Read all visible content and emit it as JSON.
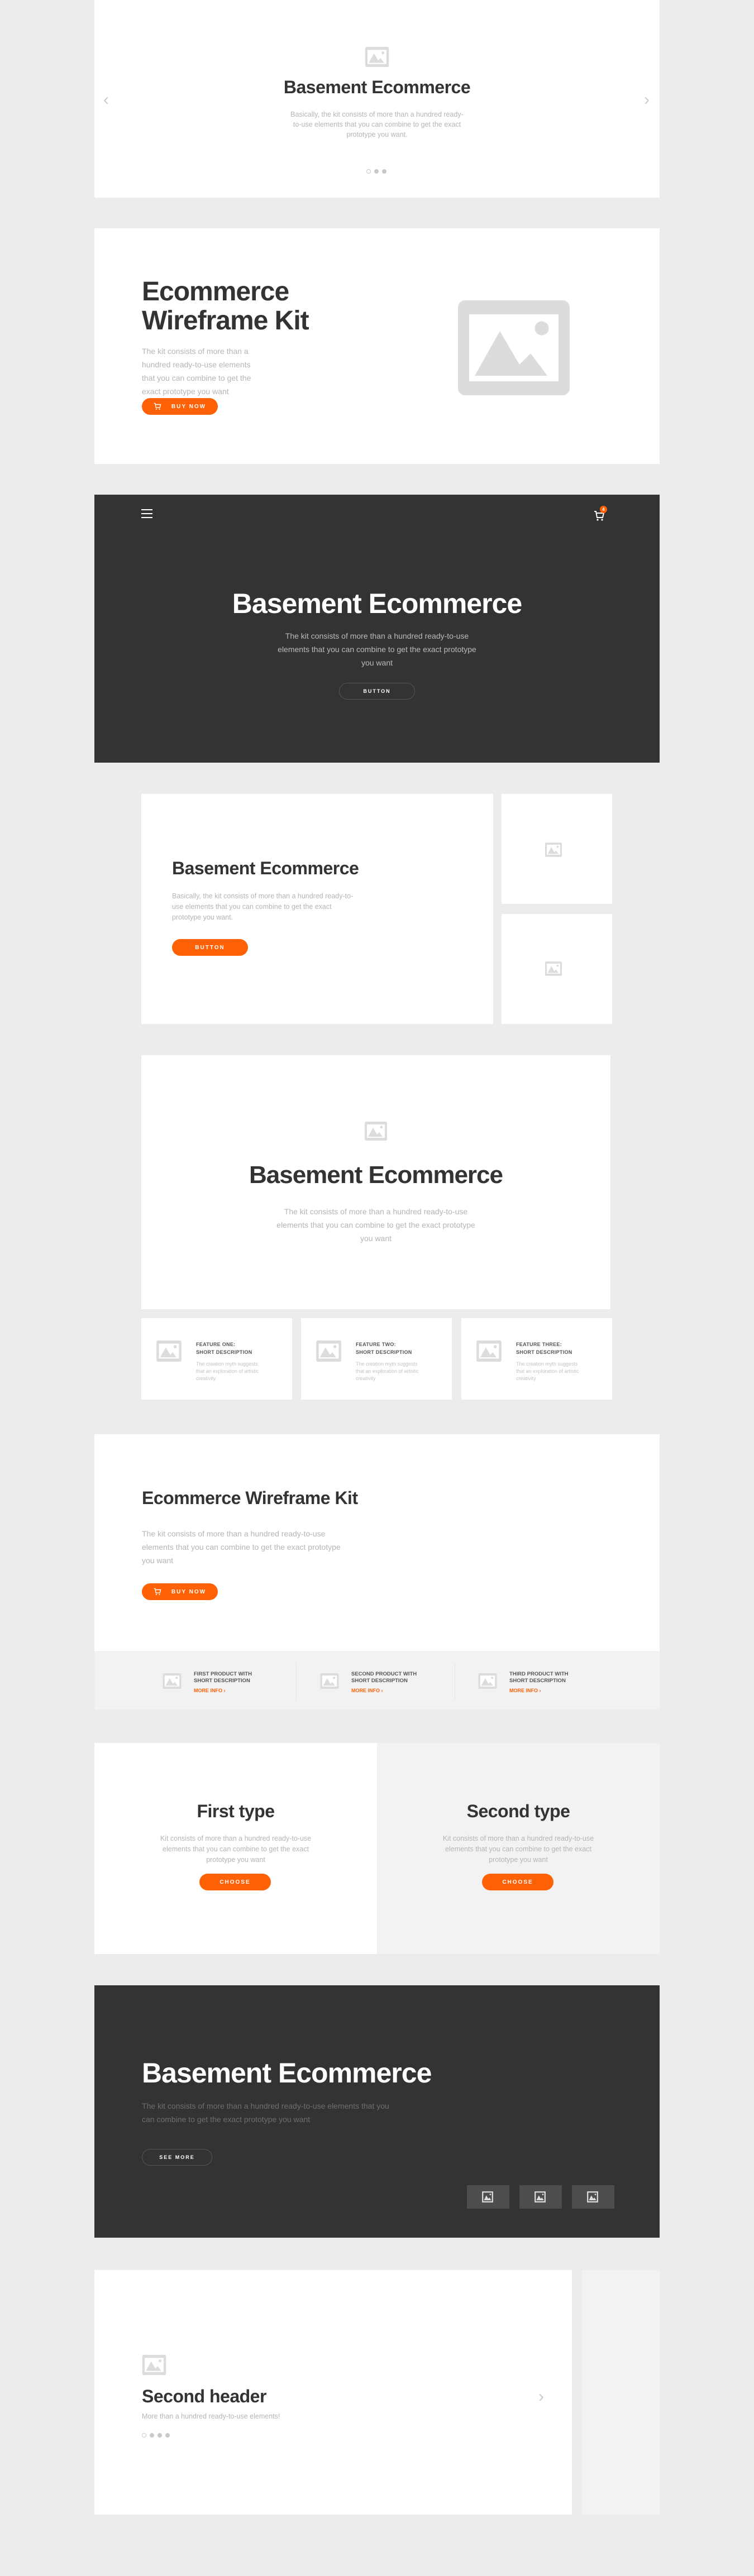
{
  "colors": {
    "accent": "#ff6206",
    "dark_bg": "#333333",
    "page_bg": "#ececec",
    "placeholder": "#dcdcdc"
  },
  "slider1": {
    "icon": "image-placeholder-icon",
    "title": "Basement Ecommerce",
    "text": "Basically, the kit consists of more than a hundred ready-to-use elements that you can combine to get the exact prototype you want.",
    "prev_icon": "chevron-left-icon",
    "next_icon": "chevron-right-icon",
    "dots": 3,
    "active_dot": 1
  },
  "hero_split": {
    "title_line1": "Ecommerce",
    "title_line2": "Wireframe Kit",
    "text": "The kit consists of more than a hundred ready-to-use elements that you can combine to get the exact prototype you want",
    "button": "BUY NOW",
    "button_icon": "cart-icon",
    "image_icon": "image-placeholder-icon"
  },
  "dark_hero": {
    "menu_icon": "hamburger-icon",
    "cart_icon": "cart-icon",
    "cart_count": "4",
    "title": "Basement Ecommerce",
    "text": "The kit consists of more than a hundred ready-to-use elements that you can combine to get the exact prototype you want",
    "button": "BUTTON"
  },
  "grid_hero": {
    "title": "Basement Ecommerce",
    "text": "Basically, the kit consists of more than a hundred ready-to-use elements that you can combine to get the exact prototype you want.",
    "button": "BUTTON"
  },
  "feature_hero": {
    "title": "Basement Ecommerce",
    "text": "The kit consists of more than a hundred ready-to-use elements that you can combine to get the exact prototype you want",
    "features": [
      {
        "title1": "FEATURE ONE:",
        "title2": "SHORT DESCRIPTION",
        "desc": "The creation myth suggests that an exploration of artistic creativity"
      },
      {
        "title1": "FEATURE TWO:",
        "title2": "SHORT DESCRIPTION",
        "desc": "The creation myth suggests that an exploration of artistic creativity"
      },
      {
        "title1": "FEATURE THREE:",
        "title2": "SHORT DESCRIPTION",
        "desc": "The creation myth suggests that an exploration of artistic creativity"
      }
    ]
  },
  "product_hero": {
    "title": "Ecommerce Wireframe Kit",
    "text": "The kit consists of more than a hundred ready-to-use elements that you can combine to get the exact prototype you want",
    "button": "BUY NOW",
    "products": [
      {
        "title1": "FIRST PRODUCT  WITH",
        "title2": "SHORT DESCRIPTION",
        "link": "MORE INFO  ›"
      },
      {
        "title1": "SECOND PRODUCT  WITH",
        "title2": "SHORT DESCRIPTION",
        "link": "MORE INFO  ›"
      },
      {
        "title1": "THIRD PRODUCT  WITH",
        "title2": "SHORT DESCRIPTION",
        "link": "MORE INFO  ›"
      }
    ]
  },
  "types": [
    {
      "title": "First type",
      "text": "Kit consists of more than a hundred ready-to-use elements that you can combine to get the exact prototype you want",
      "button": "CHOOSE"
    },
    {
      "title": "Second type",
      "text": "Kit consists of more than a hundred ready-to-use elements that you can combine to get the exact prototype you want",
      "button": "CHOOSE"
    }
  ],
  "dark_left": {
    "title": "Basement Ecommerce",
    "text": "The kit consists of more than a hundred ready-to-use elements that you can combine to get the exact prototype you want",
    "button": "SEE MORE",
    "thumbs": 3
  },
  "slider2": {
    "title": "Second header",
    "subtitle": "More than a hundred ready-to-use elements!",
    "dots": 4,
    "active_dot": 1,
    "next_icon": "chevron-right-icon"
  }
}
